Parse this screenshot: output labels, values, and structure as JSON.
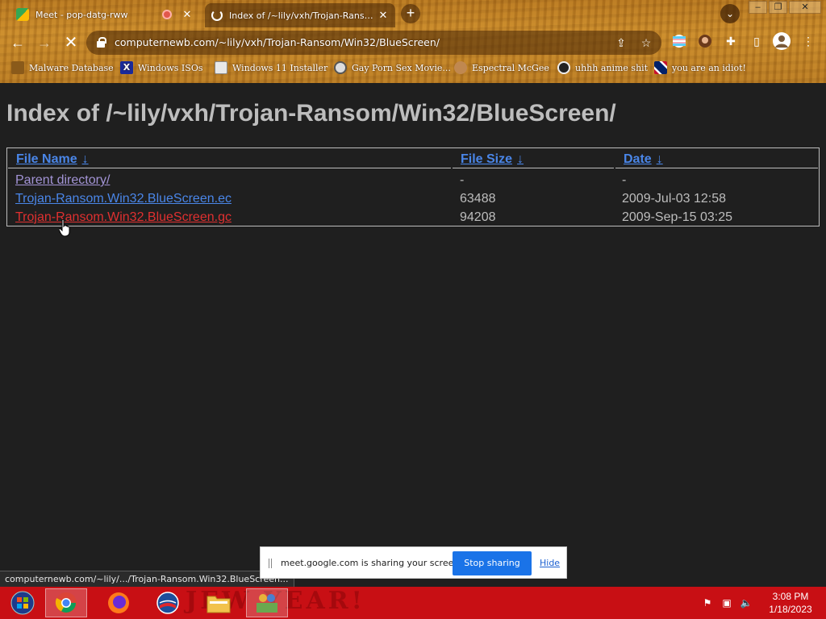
{
  "browser": {
    "tabs": [
      {
        "title": "Meet - pop-datg-rww",
        "favicon": "google-meet-icon",
        "recording": true,
        "close": "✕"
      },
      {
        "title": "Index of /~lily/vxh/Trojan-Ransom/Win32/BlueScreen/",
        "favicon": "loading-icon",
        "close": "✕"
      }
    ],
    "new_tab": "+",
    "url": "computernewb.com/~lily/vxh/Trojan-Ransom/Win32/BlueScreen/",
    "bookmarks": [
      {
        "label": "Malware Database",
        "icon": "wood-icon"
      },
      {
        "label": "Windows ISOs",
        "icon": "x-icon"
      },
      {
        "label": "Windows 11 Installer",
        "icon": "image-icon"
      },
      {
        "label": "Gay Porn Sex Movie...",
        "icon": "disk-icon"
      },
      {
        "label": "Espectral McGee",
        "icon": "face-icon"
      },
      {
        "label": "uhhh anime shit",
        "icon": "anime-icon"
      },
      {
        "label": "you are an idiot!",
        "icon": "flag-icon"
      }
    ]
  },
  "page": {
    "title": "Index of /~lily/vxh/Trojan-Ransom/Win32/BlueScreen/",
    "columns": [
      {
        "label": "File Name",
        "sort": "↓"
      },
      {
        "label": "File Size",
        "sort": "↓"
      },
      {
        "label": "Date",
        "sort": "↓"
      }
    ],
    "rows": [
      {
        "name": "Parent directory/",
        "size": "-",
        "date": "-"
      },
      {
        "name": "Trojan-Ransom.Win32.BlueScreen.ec",
        "size": "63488",
        "date": "2009-Jul-03 12:58"
      },
      {
        "name": "Trojan-Ransom.Win32.BlueScreen.gc",
        "size": "94208",
        "date": "2009-Sep-15 03:25"
      }
    ]
  },
  "status_bar": "computernewb.com/~lily/.../Trojan-Ransom.Win32.BlueScreen...",
  "share_bar": {
    "message": "meet.google.com is sharing your screen.",
    "stop_label": "Stop sharing",
    "hide_label": "Hide"
  },
  "taskbar": {
    "background_text": "JEW YEAR!",
    "time": "3:08 PM",
    "date": "1/18/2023"
  },
  "colors": {
    "link": "#4a86e8",
    "visited": "#a394d6",
    "hover": "#e03030",
    "taskbar": "#c80f14",
    "stop_button": "#1a73e8"
  }
}
